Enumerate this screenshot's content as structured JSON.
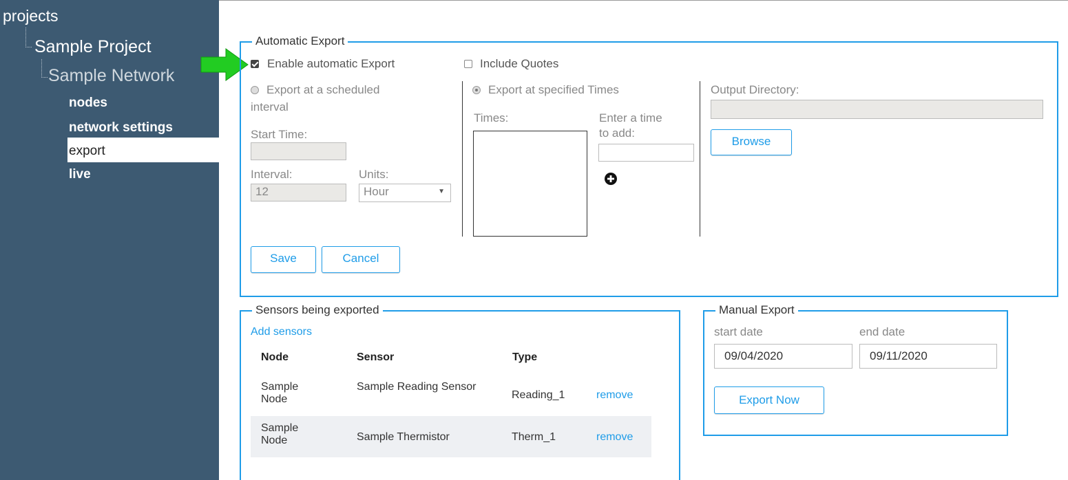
{
  "sidebar": {
    "root": "projects",
    "project": "Sample Project",
    "network": "Sample Network",
    "items": [
      {
        "label": "nodes",
        "active": false
      },
      {
        "label": "network settings",
        "active": false
      },
      {
        "label": "export",
        "active": true
      },
      {
        "label": "live",
        "active": false
      }
    ]
  },
  "automatic_export": {
    "legend": "Automatic Export",
    "enable_label": "Enable automatic Export",
    "enable_checked": true,
    "include_quotes_label": "Include Quotes",
    "include_quotes_checked": false,
    "scheduled": {
      "radio_label_line1": "Export at a scheduled",
      "radio_label_line2": "interval",
      "start_time_label": "Start Time:",
      "start_time_value": "",
      "interval_label": "Interval:",
      "interval_value": "12",
      "units_label": "Units:",
      "units_value": "Hour"
    },
    "specified": {
      "radio_label": "Export at specified Times",
      "times_label": "Times:",
      "enter_time_label_line1": "Enter a time",
      "enter_time_label_line2": "to add:",
      "enter_time_value": ""
    },
    "output": {
      "label": "Output Directory:",
      "value": "",
      "browse_label": "Browse"
    },
    "save_label": "Save",
    "cancel_label": "Cancel"
  },
  "sensors": {
    "legend": "Sensors being exported",
    "add_link": "Add sensors",
    "columns": [
      "Node",
      "Sensor",
      "Type"
    ],
    "rows": [
      {
        "node": "Sample Node",
        "sensor": "Sample Reading Sensor",
        "type": "Reading_1",
        "action": "remove"
      },
      {
        "node": "Sample Node",
        "sensor": "Sample Thermistor",
        "type": "Therm_1",
        "action": "remove"
      }
    ]
  },
  "manual_export": {
    "legend": "Manual Export",
    "start_label": "start date",
    "start_value": "09/04/2020",
    "end_label": "end date",
    "end_value": "09/11/2020",
    "export_label": "Export Now"
  },
  "colors": {
    "sidebar_bg": "#3d5a72",
    "accent": "#1e9ce8",
    "arrow": "#22cc22"
  },
  "icons": {
    "add_time": "plus-circle-icon",
    "pointer_arrow": "green-arrow-icon",
    "dropdown": "chevron-down-icon"
  }
}
